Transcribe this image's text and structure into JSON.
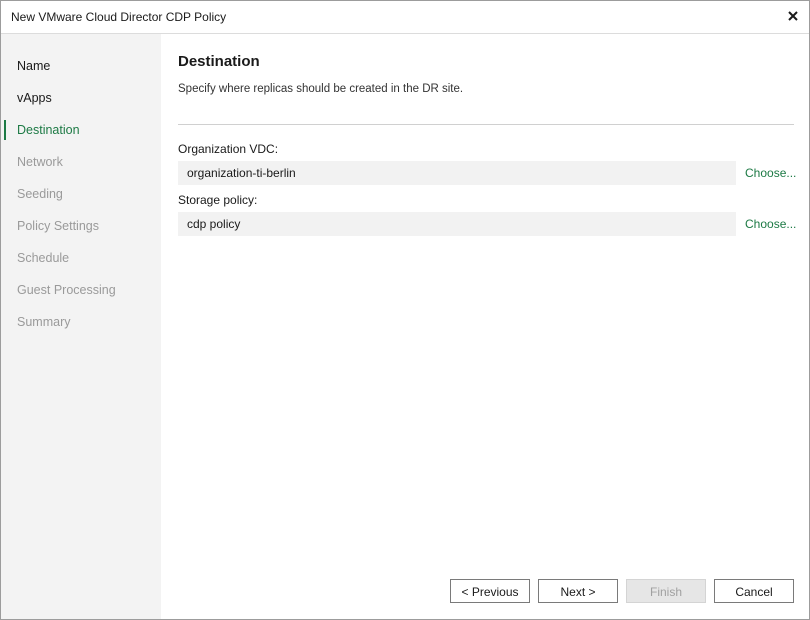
{
  "window": {
    "title": "New VMware Cloud Director CDP Policy"
  },
  "sidebar": {
    "items": [
      {
        "label": "Name",
        "state": "done"
      },
      {
        "label": "vApps",
        "state": "done"
      },
      {
        "label": "Destination",
        "state": "active"
      },
      {
        "label": "Network",
        "state": "pending"
      },
      {
        "label": "Seeding",
        "state": "pending"
      },
      {
        "label": "Policy Settings",
        "state": "pending"
      },
      {
        "label": "Schedule",
        "state": "pending"
      },
      {
        "label": "Guest Processing",
        "state": "pending"
      },
      {
        "label": "Summary",
        "state": "pending"
      }
    ]
  },
  "main": {
    "heading": "Destination",
    "description": "Specify where replicas should be created in the DR site.",
    "org_vdc": {
      "label": "Organization VDC:",
      "value": "organization-ti-berlin",
      "choose": "Choose..."
    },
    "storage_policy": {
      "label": "Storage policy:",
      "value": "cdp policy",
      "choose": "Choose..."
    }
  },
  "buttons": {
    "previous": "< Previous",
    "next": "Next >",
    "finish": "Finish",
    "cancel": "Cancel"
  },
  "colors": {
    "accent": "#1d7a45",
    "sidebar_bg": "#f3f3f3",
    "field_bg": "#f2f2f2"
  }
}
